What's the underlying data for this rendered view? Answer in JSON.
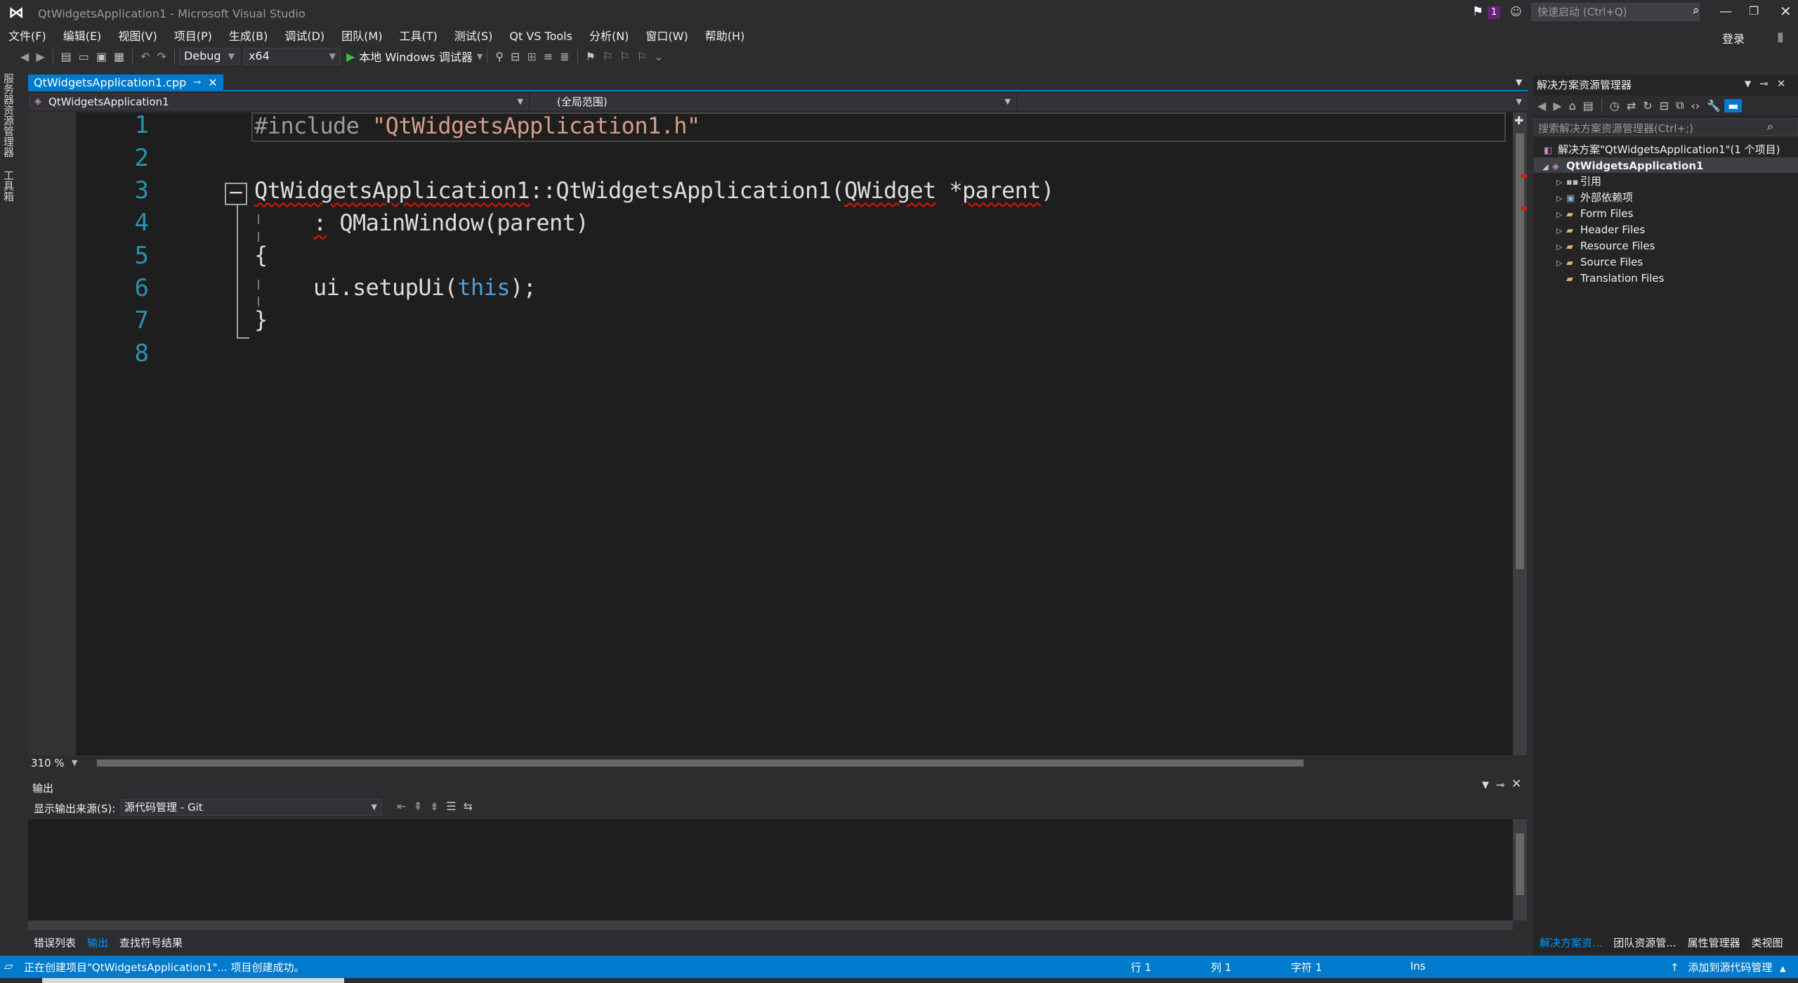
{
  "window": {
    "title": "QtWidgetsApplication1 - Microsoft Visual Studio",
    "notification_count": "1",
    "quick_launch_placeholder": "快速启动 (Ctrl+Q)",
    "login": "登录"
  },
  "menu": [
    "文件(F)",
    "编辑(E)",
    "视图(V)",
    "项目(P)",
    "生成(B)",
    "调试(D)",
    "团队(M)",
    "工具(T)",
    "测试(S)",
    "Qt VS Tools",
    "分析(N)",
    "窗口(W)",
    "帮助(H)"
  ],
  "toolbar": {
    "configuration": "Debug",
    "platform": "x64",
    "run_label": "本地 Windows 调试器"
  },
  "left_strip": [
    "服务器资源管理器",
    "工具箱"
  ],
  "editor": {
    "tab_label": "QtWidgetsApplication1.cpp",
    "nav_project": "QtWidgetsApplication1",
    "nav_scope": "(全局范围)",
    "zoom": "310 %",
    "line_numbers": [
      "1",
      "2",
      "3",
      "4",
      "5",
      "6",
      "7",
      "8"
    ]
  },
  "code": {
    "line1_directive": "#include",
    "line1_string": "\"QtWidgetsApplication1.h\"",
    "line3_class": "QtWidgetsApplication1",
    "line3_sep": "::",
    "line3_ctor": "QtWidgetsApplication1",
    "line3_paren": "(",
    "line3_type": "QWidget",
    "line3_ptr": " *",
    "line3_param": "parent",
    "line3_close": ")",
    "line4_colon": ":",
    "line4_rest": " QMainWindow(parent)",
    "line5": "{",
    "line6_pre": "ui.setupUi(",
    "line6_kw": "this",
    "line6_post": ");",
    "line7": "}"
  },
  "output": {
    "title": "输出",
    "source_label": "显示输出来源(S):",
    "source_value": "源代码管理 - Git"
  },
  "bottom_tabs": [
    "错误列表",
    "输出",
    "查找符号结果"
  ],
  "bottom_tabs_active": "输出",
  "solution_explorer": {
    "title": "解决方案资源管理器",
    "search_placeholder": "搜索解决方案资源管理器(Ctrl+;)",
    "solution": "解决方案\"QtWidgetsApplication1\"(1 个项目)",
    "project": "QtWidgetsApplication1",
    "nodes": [
      "引用",
      "外部依赖项",
      "Form Files",
      "Header Files",
      "Resource Files",
      "Source Files",
      "Translation Files"
    ],
    "tabs": [
      "解决方案资...",
      "团队资源管...",
      "属性管理器",
      "类视图"
    ]
  },
  "status": {
    "message": "正在创建项目\"QtWidgetsApplication1\"... 项目创建成功。",
    "line": "行 1",
    "col": "列 1",
    "char": "字符 1",
    "mode": "Ins",
    "source_control": "添加到源代码管理"
  },
  "colors": {
    "accent": "#007acc",
    "editor_bg": "#1e1e1e",
    "line_number": "#2b91af",
    "keyword": "#569cd6",
    "string": "#d69d85",
    "error": "#e51400"
  }
}
